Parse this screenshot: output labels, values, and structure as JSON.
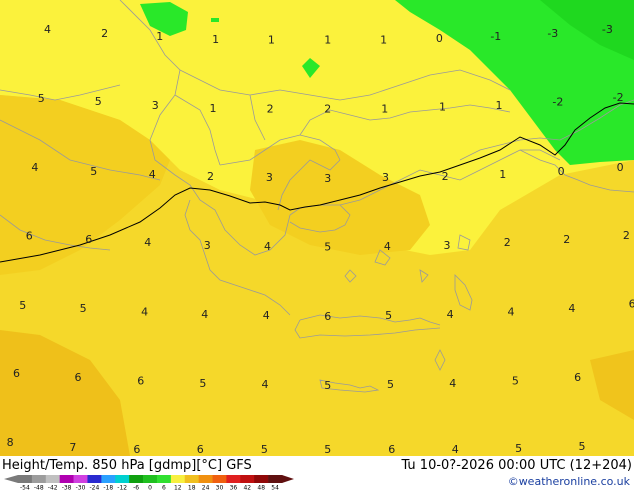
{
  "header": {
    "title_left": "Height/Temp. 850 hPa [gdmp][°C] GFS",
    "title_right": "Tu 10-0?-2026 00:00 UTC (12+204)",
    "credit": "©weatheronline.co.uk"
  },
  "colors": {
    "field_yellow_light": "#fbf23c",
    "field_yellow": "#f7e02c",
    "field_gold": "#f3cf20",
    "field_orange_yellow": "#efc01a",
    "green_bright": "#29e829",
    "green_dark": "#18c818",
    "coast": "#9a9a9a",
    "isoline": "#000000"
  },
  "colorbar": {
    "ticks": [
      "-54",
      "-48",
      "-42",
      "-38",
      "-30",
      "-24",
      "-18",
      "-12",
      "-6",
      "0",
      "6",
      "12",
      "18",
      "24",
      "30",
      "36",
      "42",
      "48",
      "54"
    ],
    "colors": [
      "#7a7a7a",
      "#9c9c9c",
      "#c0c0c0",
      "#b000b0",
      "#d040e0",
      "#2a2ad0",
      "#2aa0ff",
      "#00d0d0",
      "#10a010",
      "#20c020",
      "#30e030",
      "#f8f040",
      "#f0c020",
      "#f09010",
      "#f06010",
      "#e02020",
      "#c01010",
      "#900808",
      "#601010"
    ]
  },
  "temperature_labels": [
    {
      "value": "4",
      "col": 0.075,
      "row": 0.075
    },
    {
      "value": "2",
      "col": 0.165,
      "row": 0.083
    },
    {
      "value": "1",
      "col": 0.252,
      "row": 0.09
    },
    {
      "value": "1",
      "col": 0.34,
      "row": 0.096
    },
    {
      "value": "1",
      "col": 0.428,
      "row": 0.098
    },
    {
      "value": "1",
      "col": 0.517,
      "row": 0.098
    },
    {
      "value": "1",
      "col": 0.605,
      "row": 0.098
    },
    {
      "value": "0",
      "col": 0.693,
      "row": 0.094
    },
    {
      "value": "-1",
      "col": 0.782,
      "row": 0.09
    },
    {
      "value": "-3",
      "col": 0.872,
      "row": 0.083
    },
    {
      "value": "-3",
      "col": 0.958,
      "row": 0.075
    },
    {
      "value": "5",
      "col": 0.065,
      "row": 0.226
    },
    {
      "value": "5",
      "col": 0.155,
      "row": 0.232
    },
    {
      "value": "3",
      "col": 0.245,
      "row": 0.241
    },
    {
      "value": "1",
      "col": 0.336,
      "row": 0.248
    },
    {
      "value": "2",
      "col": 0.426,
      "row": 0.249
    },
    {
      "value": "2",
      "col": 0.517,
      "row": 0.249
    },
    {
      "value": "1",
      "col": 0.607,
      "row": 0.249
    },
    {
      "value": "1",
      "col": 0.698,
      "row": 0.245
    },
    {
      "value": "1",
      "col": 0.787,
      "row": 0.241
    },
    {
      "value": "-2",
      "col": 0.88,
      "row": 0.234
    },
    {
      "value": "-2",
      "col": 0.975,
      "row": 0.224
    },
    {
      "value": "4",
      "col": 0.055,
      "row": 0.377
    },
    {
      "value": "5",
      "col": 0.148,
      "row": 0.386
    },
    {
      "value": "4",
      "col": 0.24,
      "row": 0.393
    },
    {
      "value": "2",
      "col": 0.332,
      "row": 0.397
    },
    {
      "value": "3",
      "col": 0.425,
      "row": 0.399
    },
    {
      "value": "3",
      "col": 0.517,
      "row": 0.401
    },
    {
      "value": "3",
      "col": 0.608,
      "row": 0.399
    },
    {
      "value": "2",
      "col": 0.702,
      "row": 0.397
    },
    {
      "value": "1",
      "col": 0.793,
      "row": 0.393
    },
    {
      "value": "0",
      "col": 0.885,
      "row": 0.386
    },
    {
      "value": "0",
      "col": 0.978,
      "row": 0.377
    },
    {
      "value": "6",
      "col": 0.046,
      "row": 0.527
    },
    {
      "value": "6",
      "col": 0.14,
      "row": 0.535
    },
    {
      "value": "4",
      "col": 0.233,
      "row": 0.542
    },
    {
      "value": "3",
      "col": 0.327,
      "row": 0.548
    },
    {
      "value": "4",
      "col": 0.422,
      "row": 0.55
    },
    {
      "value": "5",
      "col": 0.517,
      "row": 0.552
    },
    {
      "value": "4",
      "col": 0.611,
      "row": 0.55
    },
    {
      "value": "3",
      "col": 0.705,
      "row": 0.548
    },
    {
      "value": "2",
      "col": 0.8,
      "row": 0.542
    },
    {
      "value": "2",
      "col": 0.894,
      "row": 0.535
    },
    {
      "value": "2",
      "col": 0.988,
      "row": 0.526
    },
    {
      "value": "5",
      "col": 0.036,
      "row": 0.68
    },
    {
      "value": "5",
      "col": 0.131,
      "row": 0.686
    },
    {
      "value": "4",
      "col": 0.228,
      "row": 0.694
    },
    {
      "value": "4",
      "col": 0.323,
      "row": 0.7
    },
    {
      "value": "4",
      "col": 0.42,
      "row": 0.702
    },
    {
      "value": "6",
      "col": 0.517,
      "row": 0.704
    },
    {
      "value": "5",
      "col": 0.613,
      "row": 0.702
    },
    {
      "value": "4",
      "col": 0.71,
      "row": 0.7
    },
    {
      "value": "4",
      "col": 0.806,
      "row": 0.694
    },
    {
      "value": "4",
      "col": 0.902,
      "row": 0.686
    },
    {
      "value": "6",
      "col": 0.997,
      "row": 0.677
    },
    {
      "value": "6",
      "col": 0.026,
      "row": 0.829
    },
    {
      "value": "6",
      "col": 0.123,
      "row": 0.838
    },
    {
      "value": "6",
      "col": 0.222,
      "row": 0.845
    },
    {
      "value": "5",
      "col": 0.32,
      "row": 0.851
    },
    {
      "value": "4",
      "col": 0.418,
      "row": 0.853
    },
    {
      "value": "5",
      "col": 0.517,
      "row": 0.855
    },
    {
      "value": "5",
      "col": 0.616,
      "row": 0.853
    },
    {
      "value": "4",
      "col": 0.714,
      "row": 0.851
    },
    {
      "value": "5",
      "col": 0.813,
      "row": 0.845
    },
    {
      "value": "6",
      "col": 0.911,
      "row": 0.838
    },
    {
      "value": "8",
      "col": 0.016,
      "row": 0.98
    },
    {
      "value": "7",
      "col": 0.115,
      "row": 0.991
    },
    {
      "value": "6",
      "col": 0.216,
      "row": 0.998
    },
    {
      "value": "6",
      "col": 0.316,
      "row": 1.0
    },
    {
      "value": "5",
      "col": 0.417,
      "row": 1.0
    },
    {
      "value": "5",
      "col": 0.517,
      "row": 1.0
    },
    {
      "value": "6",
      "col": 0.618,
      "row": 1.0
    },
    {
      "value": "4",
      "col": 0.718,
      "row": 0.998
    },
    {
      "value": "5",
      "col": 0.818,
      "row": 0.993
    },
    {
      "value": "5",
      "col": 0.918,
      "row": 0.989
    }
  ]
}
